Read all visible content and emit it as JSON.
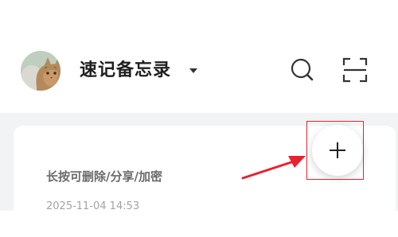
{
  "header": {
    "title": "速记备忘录",
    "avatar_icon": "cat-avatar-icon",
    "title_dropdown_icon": "caret-down-icon",
    "search_icon": "search-icon",
    "scan_icon": "scan-icon"
  },
  "note": {
    "text": "长按可删除/分享/加密",
    "date": "2025-11-04 14:53"
  },
  "add_button": {
    "icon": "plus-icon"
  },
  "annotation": {
    "arrow_color": "#e8212c",
    "box_color": "#e8212c"
  },
  "colors": {
    "background": "#f2f3f5",
    "card": "#ffffff",
    "title_text": "#1f1f1f",
    "note_text": "#6b6b6b",
    "date_text": "#a3a3a3",
    "accent_red": "#e8212c"
  }
}
